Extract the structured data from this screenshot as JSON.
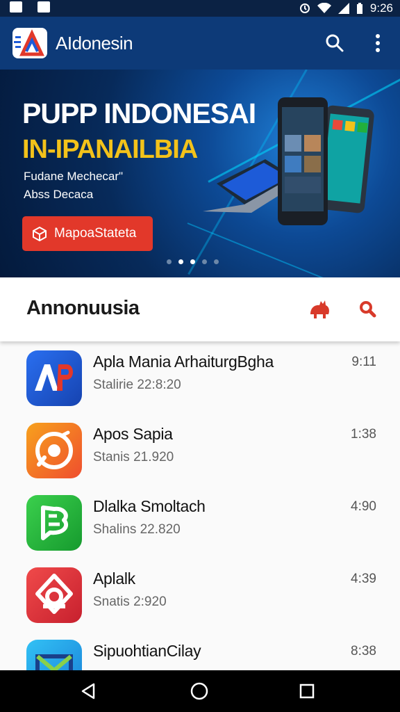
{
  "status_bar": {
    "time": "9:26",
    "icons": [
      "gallery-icon",
      "app-icon",
      "alarm-icon",
      "wifi-icon",
      "signal-icon",
      "battery-icon"
    ]
  },
  "app_bar": {
    "title": "AIdonesin",
    "icons": [
      "app-logo",
      "search-icon",
      "more-vert-icon"
    ],
    "background": "#0d3a78"
  },
  "banner": {
    "title_line1": "PUPP INDONESAI",
    "title_line2": "IN-IPANAILBIA",
    "subtitle_line1": "Fudane Mechecar\"",
    "subtitle_line2": "Abss Decaca",
    "cta_label": "MapoaStateta",
    "cta_color": "#e2382a",
    "carousel_pages": 5,
    "carousel_active": 2
  },
  "section": {
    "title": "Annonuusia",
    "icons": [
      "rooster-icon",
      "search-icon"
    ],
    "accent": "#d83a2a"
  },
  "apps": [
    {
      "name": "Apla Mania ArhaiturgBgha",
      "meta": "Stalirie 22:8:20",
      "time": "9:11",
      "icon": "ap-logo-icon",
      "color": "#1d5bd8"
    },
    {
      "name": "Apos Sapia",
      "meta": "Stanis 21.920",
      "time": "1:38",
      "icon": "camera-swirl-icon",
      "color": "#f26a2a"
    },
    {
      "name": "Dlalka Smoltach",
      "meta": "Shalins 22.820",
      "time": "4:90",
      "icon": "chat-s-icon",
      "color": "#22b03c"
    },
    {
      "name": "Aplalk",
      "meta": "Snatis 2:920",
      "time": "4:39",
      "icon": "ring-icon",
      "color": "#e2343a"
    },
    {
      "name": "SipuohtianCilay",
      "meta": "",
      "time": "8:38",
      "icon": "mail-icon",
      "color": "#1ea0e8"
    }
  ],
  "nav_bar": {
    "icons": [
      "back-icon",
      "home-icon",
      "recents-icon"
    ]
  }
}
